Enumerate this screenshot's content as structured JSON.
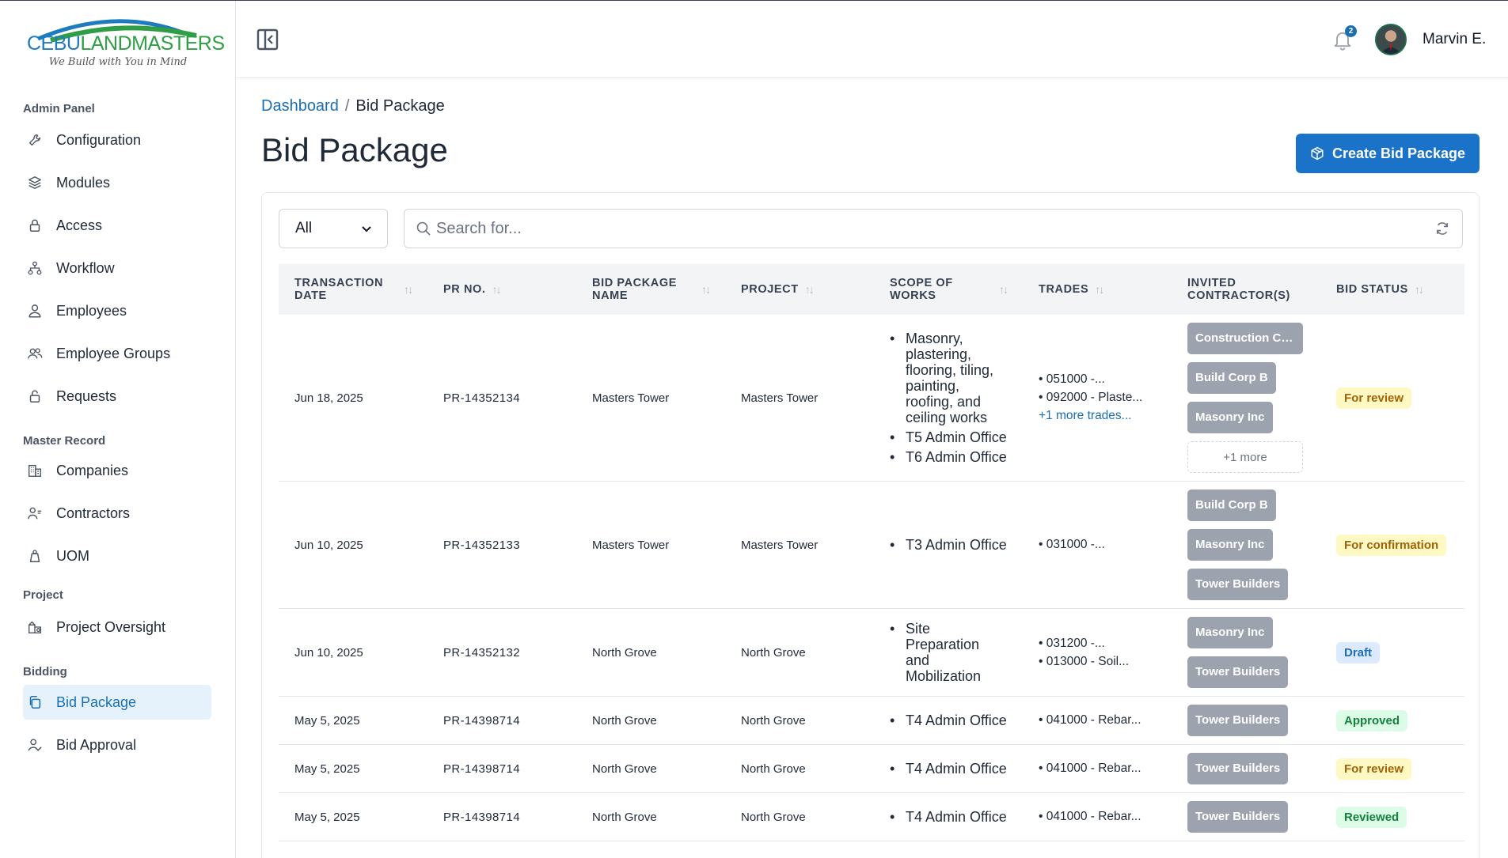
{
  "logo": {
    "word1": "CEBU",
    "word2": "LANDMASTERS",
    "tagline": "We Build with You in Mind"
  },
  "sidebar": {
    "sections": [
      {
        "title": "Admin Panel",
        "items": [
          {
            "label": "Configuration",
            "icon": "wrench-icon"
          },
          {
            "label": "Modules",
            "icon": "layers-icon"
          },
          {
            "label": "Access",
            "icon": "lock-icon"
          },
          {
            "label": "Workflow",
            "icon": "workflow-icon"
          },
          {
            "label": "Employees",
            "icon": "user-icon"
          },
          {
            "label": "Employee Groups",
            "icon": "users-icon"
          },
          {
            "label": "Requests",
            "icon": "unlock-icon"
          }
        ]
      },
      {
        "title": "Master Record",
        "items": [
          {
            "label": "Companies",
            "icon": "building-icon"
          },
          {
            "label": "Contractors",
            "icon": "contractor-icon"
          },
          {
            "label": "UOM",
            "icon": "weight-icon"
          }
        ]
      },
      {
        "title": "Project",
        "items": [
          {
            "label": "Project Oversight",
            "icon": "project-icon"
          }
        ]
      },
      {
        "title": "Bidding",
        "items": [
          {
            "label": "Bid Package",
            "icon": "copy-icon",
            "active": true
          },
          {
            "label": "Bid Approval",
            "icon": "user-check-icon"
          }
        ]
      }
    ]
  },
  "topbar": {
    "notification_count": "2",
    "user_name": "Marvin E."
  },
  "breadcrumb": {
    "home": "Dashboard",
    "separator": "/",
    "current": "Bid Package"
  },
  "page_title": "Bid Package",
  "create_button_label": "Create Bid Package",
  "filter": {
    "selected": "All"
  },
  "search": {
    "placeholder": "Search for..."
  },
  "table": {
    "columns": [
      "TRANSACTION DATE",
      "PR NO.",
      "BID PACKAGE NAME",
      "PROJECT",
      "SCOPE OF WORKS",
      "TRADES",
      "INVITED CONTRACTOR(S)",
      "BID STATUS"
    ],
    "rows": [
      {
        "date": "Jun 18, 2025",
        "pr": "PR-14352134",
        "name": "Masters Tower",
        "project": "Masters Tower",
        "scope": [
          "Masonry, plastering, flooring, tiling, painting, roofing, and ceiling works",
          "T5 Admin Office",
          "T6 Admin Office"
        ],
        "trades": [
          "051000 -...",
          "092000 - Plaste..."
        ],
        "trades_more": "+1 more trades...",
        "contractors": [
          "Construction C... A",
          "Build Corp B",
          "Masonry Inc"
        ],
        "contractors_more": "+1 more",
        "status": "For review",
        "status_class": "s-review"
      },
      {
        "date": "Jun 10, 2025",
        "pr": "PR-14352133",
        "name": "Masters Tower",
        "project": "Masters Tower",
        "scope": [
          "T3 Admin Office"
        ],
        "trades": [
          "031000 -..."
        ],
        "trades_more": "",
        "contractors": [
          "Build Corp B",
          "Masonry Inc",
          "Tower Builders"
        ],
        "contractors_more": "",
        "status": "For confirmation",
        "status_class": "s-confirm"
      },
      {
        "date": "Jun 10, 2025",
        "pr": "PR-14352132",
        "name": "North Grove",
        "project": "North Grove",
        "scope": [
          "Site Preparation and Mobilization"
        ],
        "trades": [
          "031200 -...",
          "013000 - Soil..."
        ],
        "trades_more": "",
        "contractors": [
          "Masonry Inc",
          "Tower Builders"
        ],
        "contractors_more": "",
        "status": "Draft",
        "status_class": "s-draft"
      },
      {
        "date": "May 5, 2025",
        "pr": "PR-14398714",
        "name": "North Grove",
        "project": "North Grove",
        "scope": [
          "T4 Admin Office"
        ],
        "trades": [
          "041000 - Rebar..."
        ],
        "trades_more": "",
        "contractors": [
          "Tower Builders"
        ],
        "contractors_more": "",
        "status": "Approved",
        "status_class": "s-approved"
      },
      {
        "date": "May 5, 2025",
        "pr": "PR-14398714",
        "name": "North Grove",
        "project": "North Grove",
        "scope": [
          "T4 Admin Office"
        ],
        "trades": [
          "041000 - Rebar..."
        ],
        "trades_more": "",
        "contractors": [
          "Tower Builders"
        ],
        "contractors_more": "",
        "status": "For review",
        "status_class": "s-review"
      },
      {
        "date": "May 5, 2025",
        "pr": "PR-14398714",
        "name": "North Grove",
        "project": "North Grove",
        "scope": [
          "T4 Admin Office"
        ],
        "trades": [
          "041000 - Rebar..."
        ],
        "trades_more": "",
        "contractors": [
          "Tower Builders"
        ],
        "contractors_more": "",
        "status": "Reviewed",
        "status_class": "s-reviewed"
      }
    ]
  }
}
